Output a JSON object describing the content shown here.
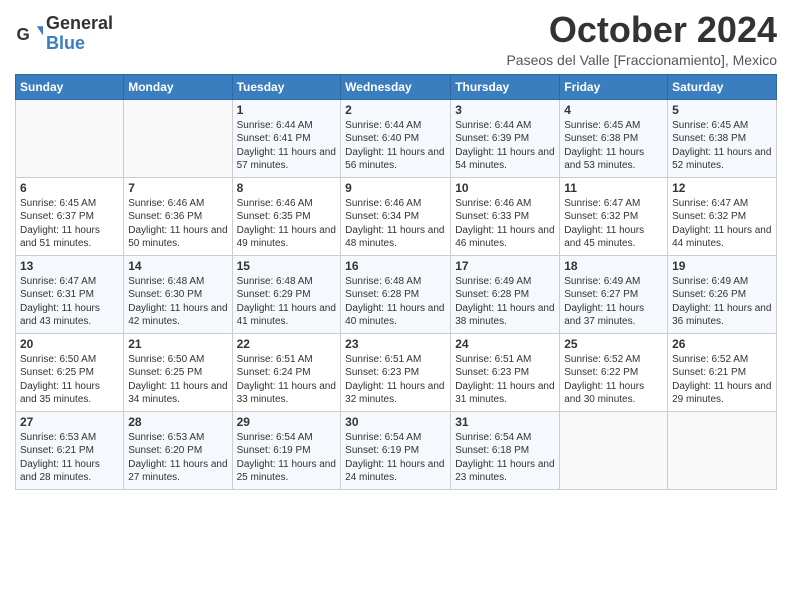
{
  "header": {
    "logo_general": "General",
    "logo_blue": "Blue",
    "month_title": "October 2024",
    "subtitle": "Paseos del Valle [Fraccionamiento], Mexico"
  },
  "weekdays": [
    "Sunday",
    "Monday",
    "Tuesday",
    "Wednesday",
    "Thursday",
    "Friday",
    "Saturday"
  ],
  "weeks": [
    [
      {
        "day": "",
        "sunrise": "",
        "sunset": "",
        "daylight": ""
      },
      {
        "day": "",
        "sunrise": "",
        "sunset": "",
        "daylight": ""
      },
      {
        "day": "1",
        "sunrise": "Sunrise: 6:44 AM",
        "sunset": "Sunset: 6:41 PM",
        "daylight": "Daylight: 11 hours and 57 minutes."
      },
      {
        "day": "2",
        "sunrise": "Sunrise: 6:44 AM",
        "sunset": "Sunset: 6:40 PM",
        "daylight": "Daylight: 11 hours and 56 minutes."
      },
      {
        "day": "3",
        "sunrise": "Sunrise: 6:44 AM",
        "sunset": "Sunset: 6:39 PM",
        "daylight": "Daylight: 11 hours and 54 minutes."
      },
      {
        "day": "4",
        "sunrise": "Sunrise: 6:45 AM",
        "sunset": "Sunset: 6:38 PM",
        "daylight": "Daylight: 11 hours and 53 minutes."
      },
      {
        "day": "5",
        "sunrise": "Sunrise: 6:45 AM",
        "sunset": "Sunset: 6:38 PM",
        "daylight": "Daylight: 11 hours and 52 minutes."
      }
    ],
    [
      {
        "day": "6",
        "sunrise": "Sunrise: 6:45 AM",
        "sunset": "Sunset: 6:37 PM",
        "daylight": "Daylight: 11 hours and 51 minutes."
      },
      {
        "day": "7",
        "sunrise": "Sunrise: 6:46 AM",
        "sunset": "Sunset: 6:36 PM",
        "daylight": "Daylight: 11 hours and 50 minutes."
      },
      {
        "day": "8",
        "sunrise": "Sunrise: 6:46 AM",
        "sunset": "Sunset: 6:35 PM",
        "daylight": "Daylight: 11 hours and 49 minutes."
      },
      {
        "day": "9",
        "sunrise": "Sunrise: 6:46 AM",
        "sunset": "Sunset: 6:34 PM",
        "daylight": "Daylight: 11 hours and 48 minutes."
      },
      {
        "day": "10",
        "sunrise": "Sunrise: 6:46 AM",
        "sunset": "Sunset: 6:33 PM",
        "daylight": "Daylight: 11 hours and 46 minutes."
      },
      {
        "day": "11",
        "sunrise": "Sunrise: 6:47 AM",
        "sunset": "Sunset: 6:32 PM",
        "daylight": "Daylight: 11 hours and 45 minutes."
      },
      {
        "day": "12",
        "sunrise": "Sunrise: 6:47 AM",
        "sunset": "Sunset: 6:32 PM",
        "daylight": "Daylight: 11 hours and 44 minutes."
      }
    ],
    [
      {
        "day": "13",
        "sunrise": "Sunrise: 6:47 AM",
        "sunset": "Sunset: 6:31 PM",
        "daylight": "Daylight: 11 hours and 43 minutes."
      },
      {
        "day": "14",
        "sunrise": "Sunrise: 6:48 AM",
        "sunset": "Sunset: 6:30 PM",
        "daylight": "Daylight: 11 hours and 42 minutes."
      },
      {
        "day": "15",
        "sunrise": "Sunrise: 6:48 AM",
        "sunset": "Sunset: 6:29 PM",
        "daylight": "Daylight: 11 hours and 41 minutes."
      },
      {
        "day": "16",
        "sunrise": "Sunrise: 6:48 AM",
        "sunset": "Sunset: 6:28 PM",
        "daylight": "Daylight: 11 hours and 40 minutes."
      },
      {
        "day": "17",
        "sunrise": "Sunrise: 6:49 AM",
        "sunset": "Sunset: 6:28 PM",
        "daylight": "Daylight: 11 hours and 38 minutes."
      },
      {
        "day": "18",
        "sunrise": "Sunrise: 6:49 AM",
        "sunset": "Sunset: 6:27 PM",
        "daylight": "Daylight: 11 hours and 37 minutes."
      },
      {
        "day": "19",
        "sunrise": "Sunrise: 6:49 AM",
        "sunset": "Sunset: 6:26 PM",
        "daylight": "Daylight: 11 hours and 36 minutes."
      }
    ],
    [
      {
        "day": "20",
        "sunrise": "Sunrise: 6:50 AM",
        "sunset": "Sunset: 6:25 PM",
        "daylight": "Daylight: 11 hours and 35 minutes."
      },
      {
        "day": "21",
        "sunrise": "Sunrise: 6:50 AM",
        "sunset": "Sunset: 6:25 PM",
        "daylight": "Daylight: 11 hours and 34 minutes."
      },
      {
        "day": "22",
        "sunrise": "Sunrise: 6:51 AM",
        "sunset": "Sunset: 6:24 PM",
        "daylight": "Daylight: 11 hours and 33 minutes."
      },
      {
        "day": "23",
        "sunrise": "Sunrise: 6:51 AM",
        "sunset": "Sunset: 6:23 PM",
        "daylight": "Daylight: 11 hours and 32 minutes."
      },
      {
        "day": "24",
        "sunrise": "Sunrise: 6:51 AM",
        "sunset": "Sunset: 6:23 PM",
        "daylight": "Daylight: 11 hours and 31 minutes."
      },
      {
        "day": "25",
        "sunrise": "Sunrise: 6:52 AM",
        "sunset": "Sunset: 6:22 PM",
        "daylight": "Daylight: 11 hours and 30 minutes."
      },
      {
        "day": "26",
        "sunrise": "Sunrise: 6:52 AM",
        "sunset": "Sunset: 6:21 PM",
        "daylight": "Daylight: 11 hours and 29 minutes."
      }
    ],
    [
      {
        "day": "27",
        "sunrise": "Sunrise: 6:53 AM",
        "sunset": "Sunset: 6:21 PM",
        "daylight": "Daylight: 11 hours and 28 minutes."
      },
      {
        "day": "28",
        "sunrise": "Sunrise: 6:53 AM",
        "sunset": "Sunset: 6:20 PM",
        "daylight": "Daylight: 11 hours and 27 minutes."
      },
      {
        "day": "29",
        "sunrise": "Sunrise: 6:54 AM",
        "sunset": "Sunset: 6:19 PM",
        "daylight": "Daylight: 11 hours and 25 minutes."
      },
      {
        "day": "30",
        "sunrise": "Sunrise: 6:54 AM",
        "sunset": "Sunset: 6:19 PM",
        "daylight": "Daylight: 11 hours and 24 minutes."
      },
      {
        "day": "31",
        "sunrise": "Sunrise: 6:54 AM",
        "sunset": "Sunset: 6:18 PM",
        "daylight": "Daylight: 11 hours and 23 minutes."
      },
      {
        "day": "",
        "sunrise": "",
        "sunset": "",
        "daylight": ""
      },
      {
        "day": "",
        "sunrise": "",
        "sunset": "",
        "daylight": ""
      }
    ]
  ]
}
